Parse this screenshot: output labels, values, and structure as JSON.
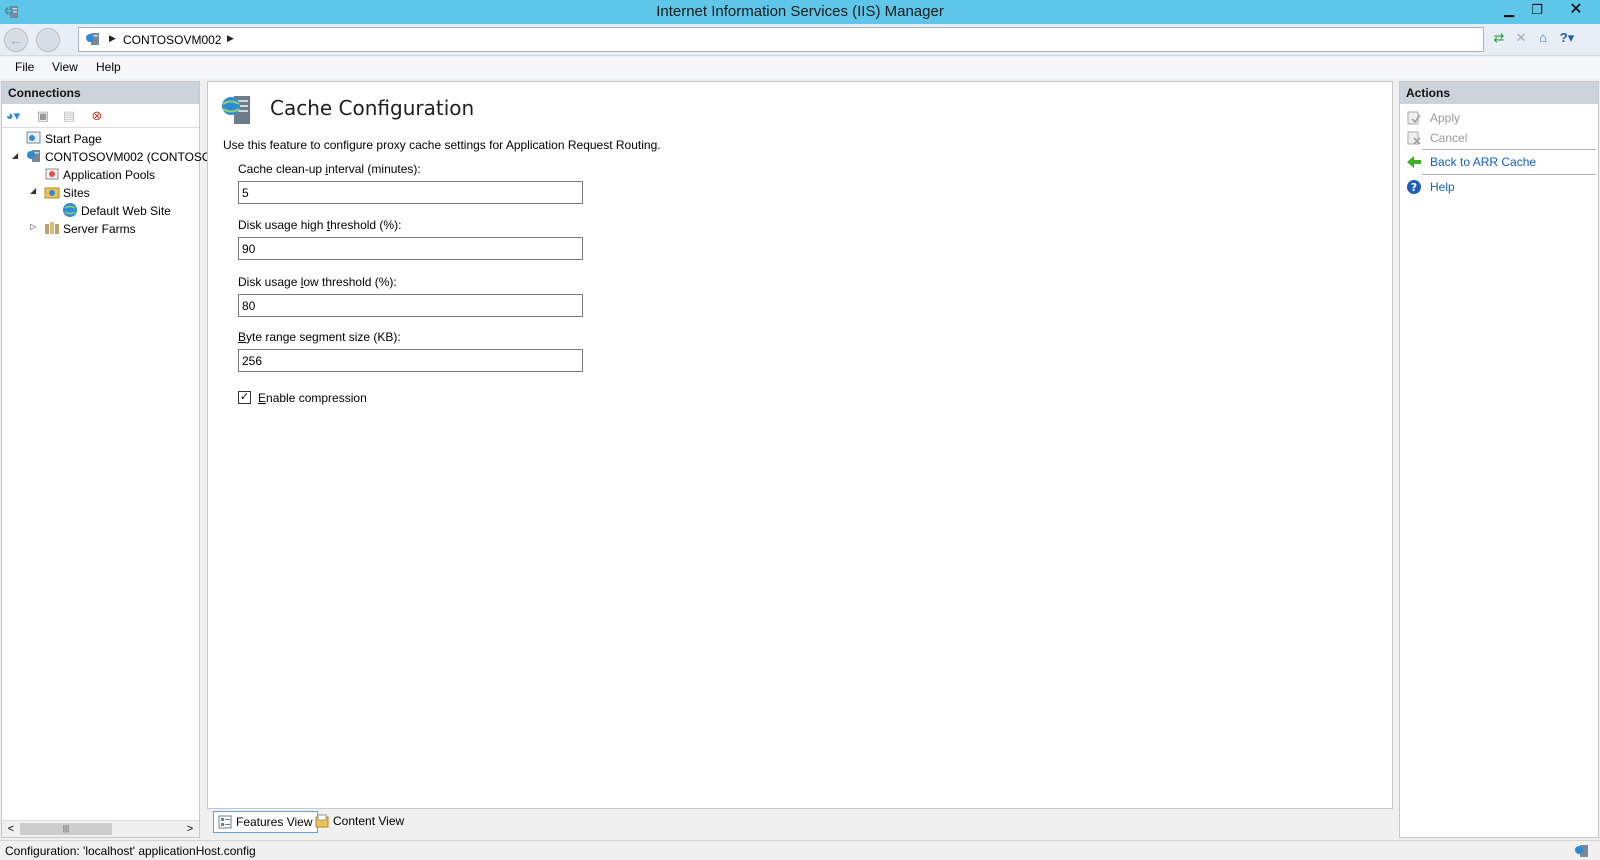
{
  "window": {
    "title": "Internet Information Services (IIS) Manager",
    "minimize": "▁",
    "restore": "❐",
    "close": "✕"
  },
  "address_bar": {
    "crumbs": [
      "CONTOSOVM002"
    ]
  },
  "menu": [
    "File",
    "View",
    "Help"
  ],
  "connections": {
    "title": "Connections",
    "tree": [
      {
        "label": "Start Page",
        "icon": "start-page-icon"
      },
      {
        "label": "CONTOSOVM002 (CONTOSO\\",
        "icon": "server-icon"
      },
      {
        "label": "Application Pools",
        "icon": "app-pools-icon"
      },
      {
        "label": "Sites",
        "icon": "sites-folder-icon"
      },
      {
        "label": "Default Web Site",
        "icon": "globe-icon"
      },
      {
        "label": "Server Farms",
        "icon": "server-farms-icon"
      }
    ]
  },
  "feature": {
    "title": "Cache Configuration",
    "description": "Use this feature to configure proxy cache settings for Application Request Routing.",
    "fields": [
      {
        "label_pre": "Cache clean-up ",
        "label_u": "i",
        "label_post": "nterval (minutes):",
        "value": "5"
      },
      {
        "label_pre": "Disk usage high ",
        "label_u": "t",
        "label_post": "hreshold (%):",
        "value": "90"
      },
      {
        "label_pre": "Disk usage ",
        "label_u": "l",
        "label_post": "ow threshold (%):",
        "value": "80"
      },
      {
        "label_pre": "",
        "label_u": "B",
        "label_post": "yte range segment size (KB):",
        "value": "256"
      }
    ],
    "compression": {
      "label_u": "E",
      "label_post": "nable compression",
      "checked": true
    }
  },
  "view_tabs": {
    "features": "Features View",
    "content": "Content View"
  },
  "actions": {
    "title": "Actions",
    "apply": "Apply",
    "cancel": "Cancel",
    "back": "Back to ARR Cache",
    "help": "Help"
  },
  "status": {
    "text": "Configuration: 'localhost' applicationHost.config"
  },
  "colors": {
    "titlebar": "#5ec6e9",
    "link": "#1560b8",
    "disabled": "#9a9a9a"
  }
}
